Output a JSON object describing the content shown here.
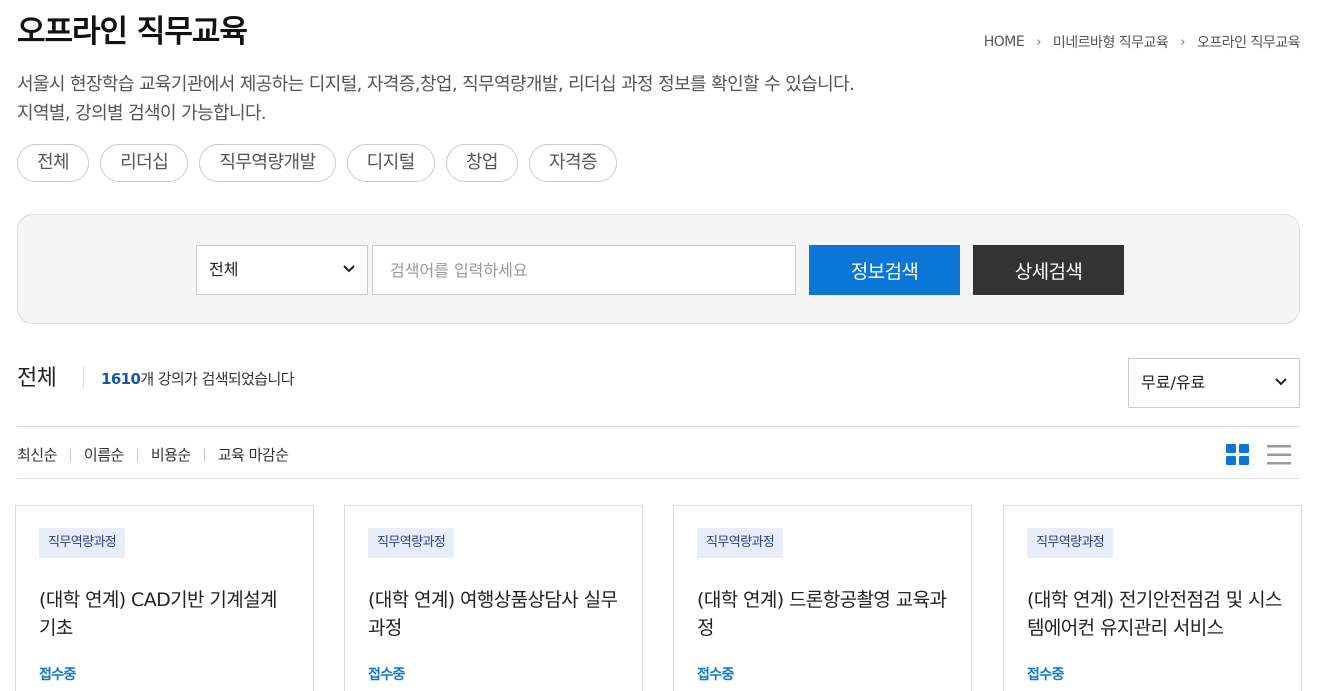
{
  "page": {
    "title": "오프라인 직무교육",
    "description_line1": "서울시 현장학습 교육기관에서 제공하는 디지털, 자격증,창업, 직무역량개발, 리더십 과정 정보를 확인할 수 있습니다.",
    "description_line2": "지역별, 강의별 검색이 가능합니다."
  },
  "breadcrumb": {
    "items": [
      "HOME",
      "미네르바형 직무교육",
      "오프라인 직무교육"
    ],
    "separator": "›"
  },
  "categories": [
    "전체",
    "리더십",
    "직무역량개발",
    "디지털",
    "창업",
    "자격증"
  ],
  "search": {
    "scope_value": "전체",
    "placeholder": "검색어를 입력하세요",
    "query": "",
    "search_button": "정보검색",
    "advanced_button": "상세검색"
  },
  "results": {
    "heading": "전체",
    "count": "1610",
    "count_suffix": "개 강의가 검색되었습니다",
    "fee_filter": "무료/유료"
  },
  "sort_options": [
    "최신순",
    "이름순",
    "비용순",
    "교육 마감순"
  ],
  "view_modes": {
    "grid_icon": "grid-view-icon",
    "list_icon": "list-view-icon",
    "active": "grid"
  },
  "colors": {
    "accent": "#0b76d6",
    "dark_button": "#333333",
    "count": "#0f5ca8",
    "badge_bg": "#e8edfb"
  },
  "courses": [
    {
      "badge": "직무역량과정",
      "title": "(대학 연계) CAD기반 기계설계 기초",
      "status": "접수중"
    },
    {
      "badge": "직무역량과정",
      "title": "(대학 연계) 여행상품상담사 실무과정",
      "status": "접수중"
    },
    {
      "badge": "직무역량과정",
      "title": "(대학 연계) 드론항공촬영 교육과정",
      "status": "접수중"
    },
    {
      "badge": "직무역량과정",
      "title": "(대학 연계) 전기안전점검 및 시스템에어컨 유지관리 서비스",
      "status": "접수중"
    }
  ]
}
